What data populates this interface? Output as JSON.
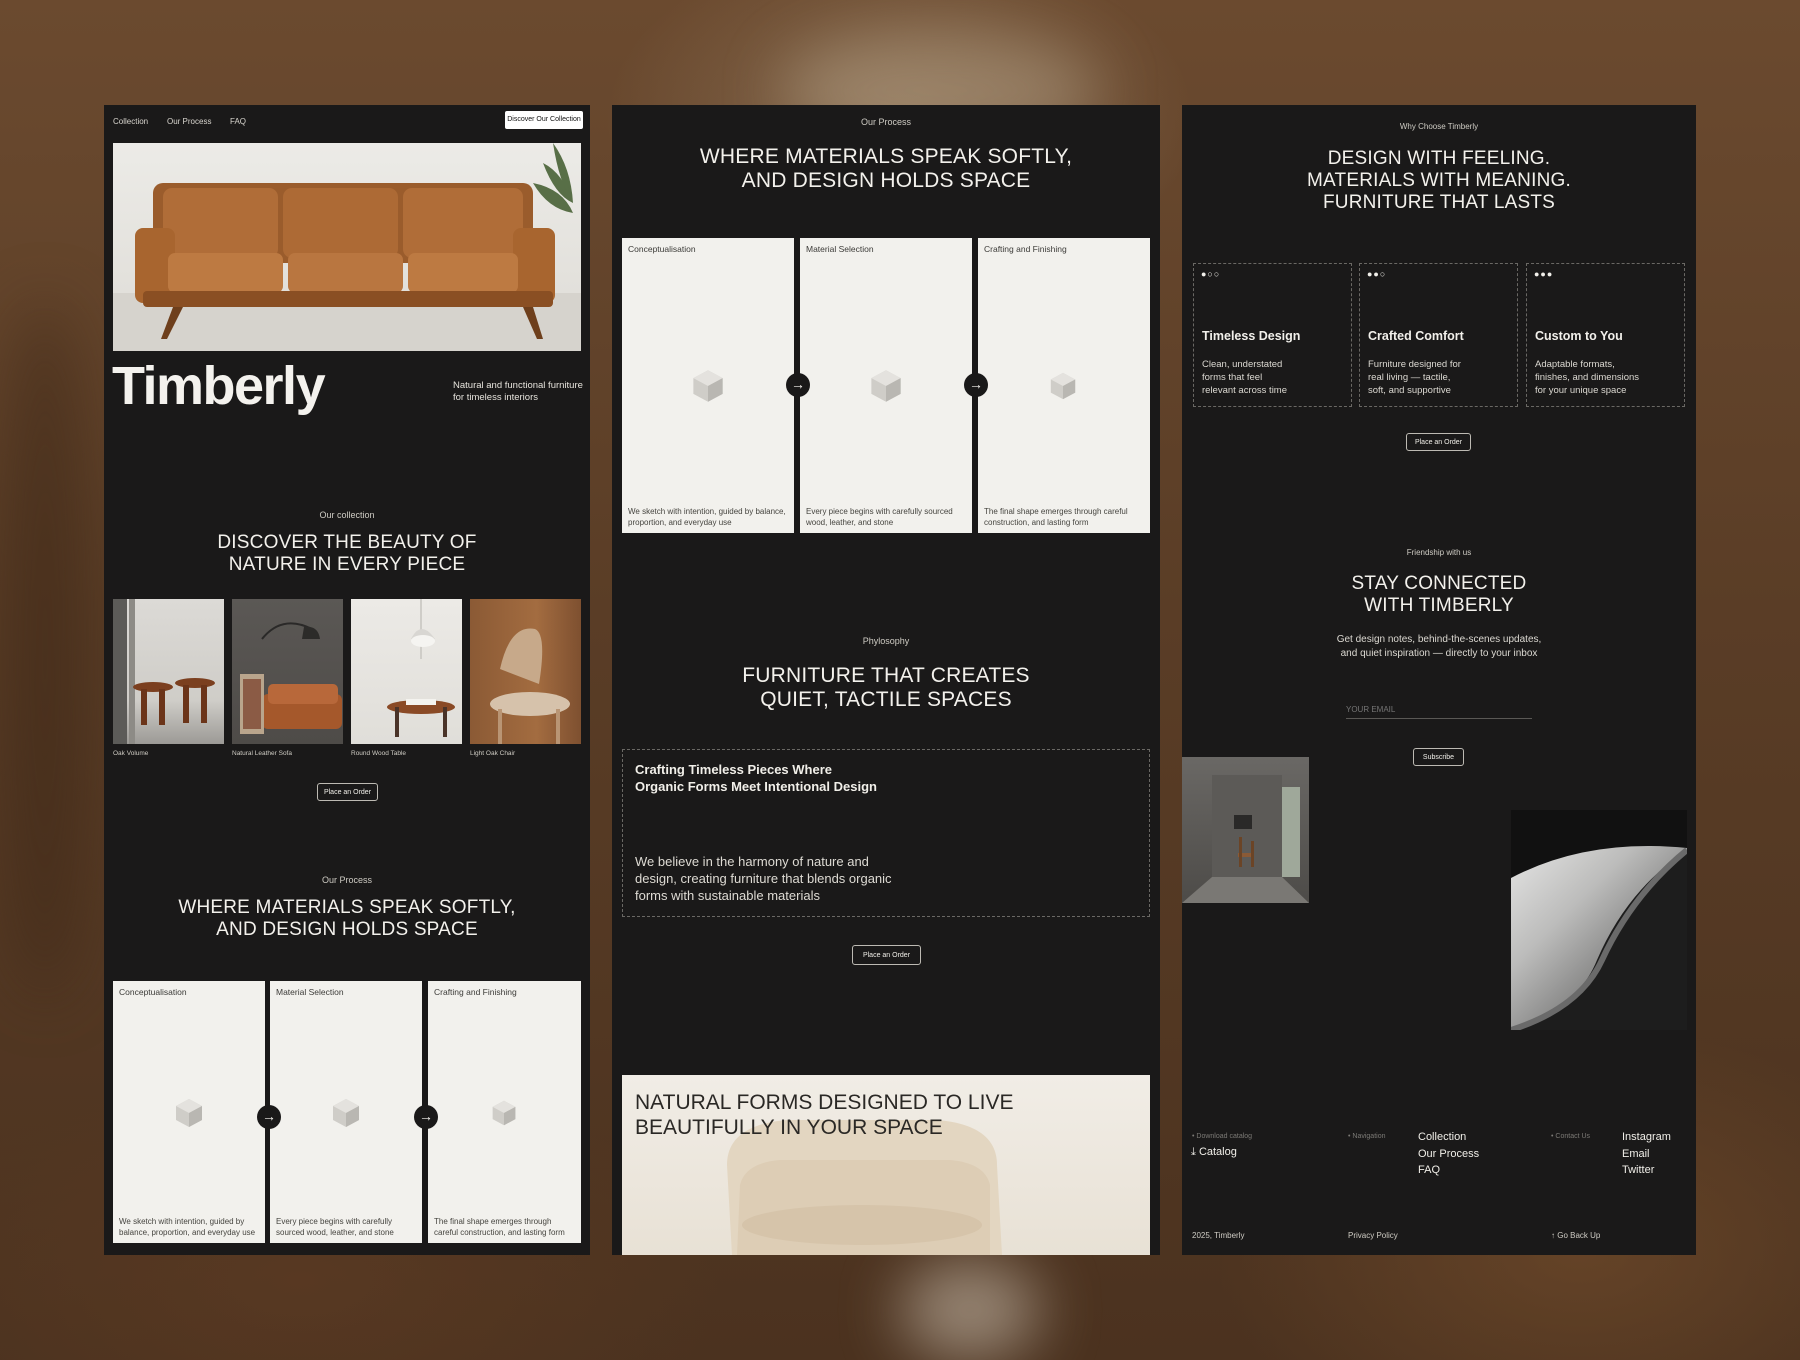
{
  "panel1": {
    "nav": {
      "items": [
        "Collection",
        "Our Process",
        "FAQ"
      ],
      "cta": "Discover Our Collection"
    },
    "hero": {
      "brand": "Timberly",
      "tagline": "Natural and functional furniture for timeless interiors"
    },
    "collection": {
      "eyebrow": "Our collection",
      "title_line1": "DISCOVER THE BEAUTY OF",
      "title_line2": "NATURE IN EVERY PIECE",
      "items": [
        "Oak Volume",
        "Natural Leather Sofa",
        "Round Wood Table",
        "Light Oak Chair"
      ],
      "cta": "Place an Order"
    },
    "process": {
      "eyebrow": "Our Process",
      "title_line1": "WHERE MATERIALS SPEAK SOFTLY,",
      "title_line2": "AND DESIGN HOLDS SPACE",
      "steps": [
        {
          "label": "Conceptualisation",
          "desc": "We sketch with intention, guided by balance, proportion, and everyday use"
        },
        {
          "label": "Material Selection",
          "desc": "Every piece begins with carefully sourced wood, leather, and stone"
        },
        {
          "label": "Crafting and Finishing",
          "desc": "The final shape emerges through careful construction, and lasting form"
        }
      ]
    }
  },
  "panel2": {
    "process": {
      "eyebrow": "Our Process",
      "title_line1": "WHERE MATERIALS SPEAK SOFTLY,",
      "title_line2": "AND DESIGN HOLDS SPACE",
      "steps": [
        {
          "label": "Conceptualisation",
          "desc": "We sketch with intention, guided by balance, proportion, and everyday use"
        },
        {
          "label": "Material Selection",
          "desc": "Every piece begins with carefully sourced wood, leather, and stone"
        },
        {
          "label": "Crafting and Finishing",
          "desc": "The final shape emerges through careful construction, and lasting form"
        }
      ]
    },
    "philosophy": {
      "eyebrow": "Phylosophy",
      "title_line1": "FURNITURE THAT CREATES",
      "title_line2": "QUIET, TACTILE SPACES",
      "card_title_line1": "Crafting Timeless Pieces Where",
      "card_title_line2": "Organic Forms Meet Intentional Design",
      "card_body_line1": "We believe in the harmony of nature and",
      "card_body_line2": "design, creating furniture that blends organic",
      "card_body_line3": "forms with sustainable materials",
      "cta": "Place an Order"
    },
    "banner": {
      "line1": "NATURAL FORMS DESIGNED TO LIVE",
      "line2": "BEAUTIFULLY IN YOUR SPACE"
    }
  },
  "panel3": {
    "why": {
      "eyebrow": "Why Choose Timberly",
      "title_line1": "DESIGN WITH FEELING.",
      "title_line2": "MATERIALS WITH MEANING.",
      "title_line3": "FURNITURE THAT LASTS",
      "features": [
        {
          "title": "Timeless Design",
          "l1": "Clean, understated",
          "l2": "forms that feel",
          "l3": "relevant across time",
          "filled_dots": 1
        },
        {
          "title": "Crafted Comfort",
          "l1": "Furniture designed for",
          "l2": "real living — tactile,",
          "l3": "soft, and supportive",
          "filled_dots": 2
        },
        {
          "title": "Custom to You",
          "l1": "Adaptable formats,",
          "l2": "finishes, and dimensions",
          "l3": "for your unique space",
          "filled_dots": 3
        }
      ],
      "cta": "Place an Order"
    },
    "newsletter": {
      "eyebrow": "Friendship with us",
      "title_line1": "STAY CONNECTED",
      "title_line2": "WITH TIMBERLY",
      "body_line1": "Get design notes, behind-the-scenes updates,",
      "body_line2": "and quiet inspiration — directly to your inbox",
      "placeholder": "YOUR EMAIL",
      "cta": "Subscribe"
    },
    "footer": {
      "download_label": "Download catalog",
      "catalog": "Catalog",
      "nav_label": "Navigation",
      "nav_links": [
        "Collection",
        "Our Process",
        "FAQ"
      ],
      "contact_label": "Contact Us",
      "contact_links": [
        "Instagram",
        "Email",
        "Twitter"
      ],
      "copyright": "2025, Timberly",
      "privacy": "Privacy Policy",
      "back_up": "Go Back Up"
    }
  },
  "colors": {
    "panel_bg": "#1a1919",
    "card_bg": "#f2f1ed",
    "page_bg": "#5a3d26",
    "text_light": "#f2f0eb"
  },
  "icons": [
    "cube-icon",
    "arrow-right-icon",
    "download-icon",
    "arrow-up-icon",
    "dot-indicator-icon"
  ]
}
